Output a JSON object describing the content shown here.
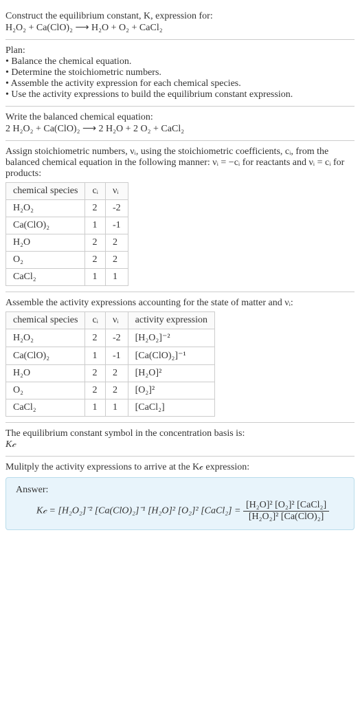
{
  "intro": {
    "line1": "Construct the equilibrium constant, K, expression for:",
    "equation": "H₂O₂ + Ca(ClO)₂ ⟶ H₂O + O₂ + CaCl₂"
  },
  "plan": {
    "title": "Plan:",
    "items": [
      "• Balance the chemical equation.",
      "• Determine the stoichiometric numbers.",
      "• Assemble the activity expression for each chemical species.",
      "• Use the activity expressions to build the equilibrium constant expression."
    ]
  },
  "balanced": {
    "title": "Write the balanced chemical equation:",
    "equation": "2 H₂O₂ + Ca(ClO)₂ ⟶ 2 H₂O + 2 O₂ + CaCl₂"
  },
  "assign": {
    "text": "Assign stoichiometric numbers, νᵢ, using the stoichiometric coefficients, cᵢ, from the balanced chemical equation in the following manner: νᵢ = −cᵢ for reactants and νᵢ = cᵢ for products:",
    "headers": [
      "chemical species",
      "cᵢ",
      "νᵢ"
    ],
    "rows": [
      [
        "H₂O₂",
        "2",
        "-2"
      ],
      [
        "Ca(ClO)₂",
        "1",
        "-1"
      ],
      [
        "H₂O",
        "2",
        "2"
      ],
      [
        "O₂",
        "2",
        "2"
      ],
      [
        "CaCl₂",
        "1",
        "1"
      ]
    ]
  },
  "activity": {
    "text": "Assemble the activity expressions accounting for the state of matter and νᵢ:",
    "headers": [
      "chemical species",
      "cᵢ",
      "νᵢ",
      "activity expression"
    ],
    "rows": [
      [
        "H₂O₂",
        "2",
        "-2",
        "[H₂O₂]⁻²"
      ],
      [
        "Ca(ClO)₂",
        "1",
        "-1",
        "[Ca(ClO)₂]⁻¹"
      ],
      [
        "H₂O",
        "2",
        "2",
        "[H₂O]²"
      ],
      [
        "O₂",
        "2",
        "2",
        "[O₂]²"
      ],
      [
        "CaCl₂",
        "1",
        "1",
        "[CaCl₂]"
      ]
    ]
  },
  "symbol": {
    "text": "The equilibrium constant symbol in the concentration basis is:",
    "value": "K𝒸"
  },
  "multiply": {
    "text": "Mulitply the activity expressions to arrive at the K𝒸 expression:"
  },
  "answer": {
    "label": "Answer:",
    "lhs": "K𝒸 = [H₂O₂]⁻² [Ca(ClO)₂]⁻¹ [H₂O]² [O₂]² [CaCl₂] =",
    "frac_num": "[H₂O]² [O₂]² [CaCl₂]",
    "frac_den": "[H₂O₂]² [Ca(ClO)₂]"
  }
}
